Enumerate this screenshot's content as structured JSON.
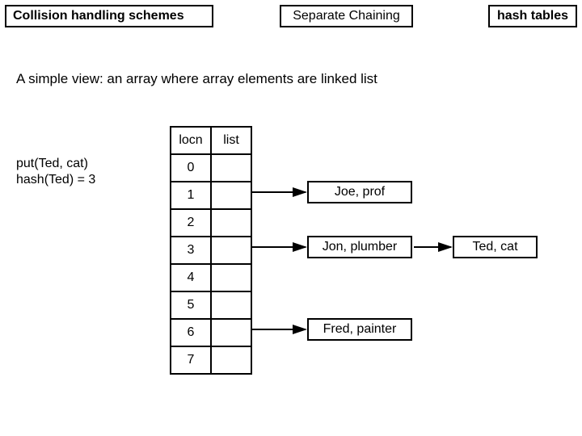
{
  "header": {
    "left": "Collision handling schemes",
    "middle": "Separate Chaining",
    "right": "hash tables"
  },
  "subtitle": "A simple view: an array where array elements are linked list",
  "operation": {
    "line1": "put(Ted, cat)",
    "line2": "hash(Ted) = 3"
  },
  "table": {
    "head_locn": "locn",
    "head_list": "list",
    "rows": [
      "0",
      "1",
      "2",
      "3",
      "4",
      "5",
      "6",
      "7"
    ]
  },
  "nodes": {
    "n1": "Joe, prof",
    "n3a": "Jon, plumber",
    "n3b": "Ted, cat",
    "n6": "Fred, painter"
  }
}
